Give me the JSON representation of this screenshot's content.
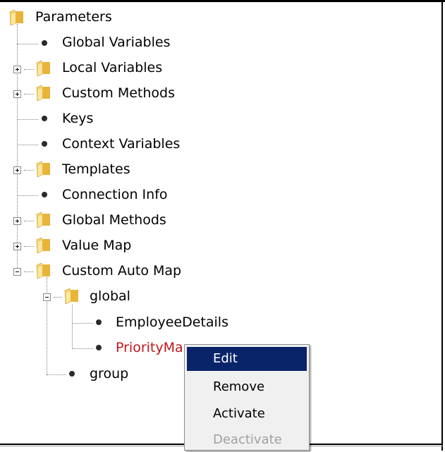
{
  "tree": {
    "root": "Parameters",
    "items": [
      {
        "label": "Global Variables",
        "type": "leaf"
      },
      {
        "label": "Local Variables",
        "type": "folder"
      },
      {
        "label": "Custom Methods",
        "type": "folder"
      },
      {
        "label": "Keys",
        "type": "leaf"
      },
      {
        "label": "Context Variables",
        "type": "leaf"
      },
      {
        "label": "Templates",
        "type": "folder"
      },
      {
        "label": "Connection Info",
        "type": "leaf"
      },
      {
        "label": "Global Methods",
        "type": "folder"
      },
      {
        "label": "Value Map",
        "type": "folder"
      },
      {
        "label": "Custom Auto Map",
        "type": "folder",
        "expanded": true
      },
      {
        "label": "global",
        "type": "folder",
        "expanded": true
      },
      {
        "label": "EmployeeDetails",
        "type": "leaf"
      },
      {
        "label": "PriorityMa",
        "type": "leaf",
        "selected": true
      },
      {
        "label": "group",
        "type": "leaf"
      }
    ]
  },
  "context_menu": {
    "items": [
      {
        "label": "Edit",
        "state": "highlighted"
      },
      {
        "label": "Remove",
        "state": "enabled"
      },
      {
        "label": "Activate",
        "state": "enabled"
      },
      {
        "label": "Deactivate",
        "state": "disabled"
      }
    ]
  },
  "colors": {
    "selected_text": "#c0161c",
    "menu_highlight": "#0a246a",
    "folder": "#e8b53a"
  }
}
